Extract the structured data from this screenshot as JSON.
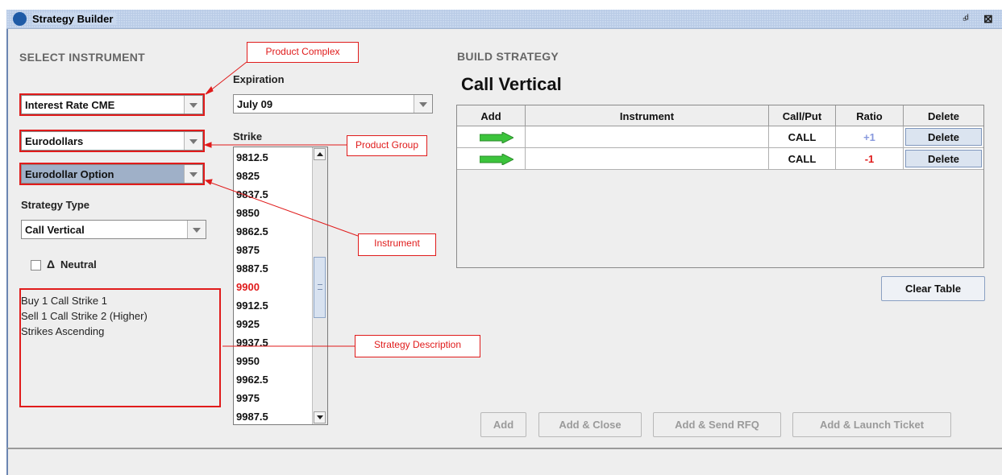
{
  "window": {
    "title": "Strategy Builder"
  },
  "select_instrument": {
    "heading": "SELECT INSTRUMENT",
    "product_complex": "Interest Rate CME",
    "product_group": "Eurodollars",
    "instrument": "Eurodollar Option",
    "strategy_type_label": "Strategy Type",
    "strategy_type": "Call Vertical",
    "neutral_label": "Neutral",
    "neutral_symbol": "Δ",
    "description": [
      "Buy 1 Call Strike 1",
      "Sell 1 Call Strike 2 (Higher)",
      "Strikes Ascending"
    ]
  },
  "expiration": {
    "label": "Expiration",
    "value": "July 09"
  },
  "strike": {
    "label": "Strike",
    "items": [
      "9812.5",
      "9825",
      "9837.5",
      "9850",
      "9862.5",
      "9875",
      "9887.5",
      "9900",
      "9912.5",
      "9925",
      "9937.5",
      "9950",
      "9962.5",
      "9975",
      "9987.5"
    ],
    "highlighted": "9900",
    "highlight_color": "#e01b1b"
  },
  "callouts": {
    "product_complex": "Product Complex",
    "product_group": "Product Group",
    "instrument": "Instrument",
    "strategy_description": "Strategy Description",
    "color": "#e01b1b"
  },
  "build_strategy": {
    "heading": "BUILD STRATEGY",
    "strategy_name": "Call Vertical",
    "columns": [
      "Add",
      "Instrument",
      "Call/Put",
      "Ratio",
      "Delete"
    ],
    "rows": [
      {
        "instrument": "",
        "call_put": "CALL",
        "ratio": "+1",
        "ratio_color": "#8899dd",
        "delete": "Delete"
      },
      {
        "instrument": "",
        "call_put": "CALL",
        "ratio": "-1",
        "ratio_color": "#e01b1b",
        "delete": "Delete"
      }
    ],
    "clear_table": "Clear Table",
    "buttons": [
      "Add",
      "Add & Close",
      "Add & Send RFQ",
      "Add & Launch Ticket"
    ]
  }
}
